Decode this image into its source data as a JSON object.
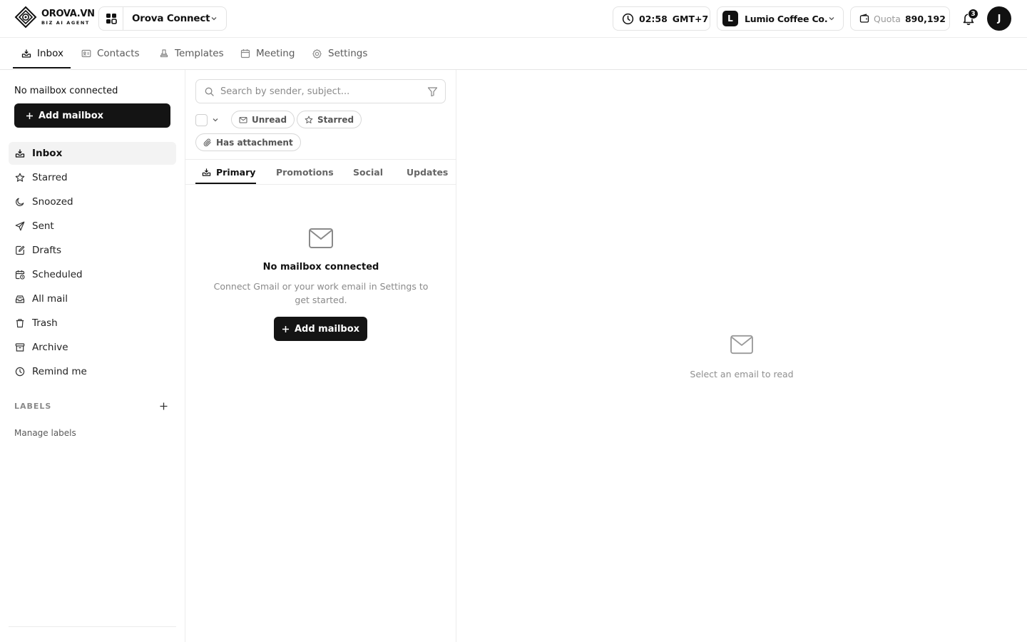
{
  "brand": {
    "name": "OROVA.VN",
    "tagline": "BIZ AI AGENT"
  },
  "app_switcher": {
    "current_app": "Orova Connect"
  },
  "clock": {
    "time": "02:58",
    "timezone": "GMT+7"
  },
  "org": {
    "initial": "L",
    "name": "Lumio Coffee Co."
  },
  "quota": {
    "label": "Quota",
    "value": "890,192"
  },
  "notifications": {
    "count": "3"
  },
  "user": {
    "initial": "J"
  },
  "nav": {
    "tabs": [
      {
        "label": "Inbox",
        "icon": "inbox-icon",
        "active": true
      },
      {
        "label": "Contacts",
        "icon": "contact-card-icon"
      },
      {
        "label": "Templates",
        "icon": "stamp-icon"
      },
      {
        "label": "Meeting",
        "icon": "calendar-icon"
      },
      {
        "label": "Settings",
        "icon": "gear-icon"
      }
    ]
  },
  "sidebar": {
    "status": "No mailbox connected",
    "add_mailbox_label": "Add mailbox",
    "folders": [
      {
        "label": "Inbox",
        "icon": "inbox-icon",
        "active": true
      },
      {
        "label": "Starred",
        "icon": "star-icon"
      },
      {
        "label": "Snoozed",
        "icon": "moon-icon"
      },
      {
        "label": "Sent",
        "icon": "send-icon"
      },
      {
        "label": "Drafts",
        "icon": "draft-icon"
      },
      {
        "label": "Scheduled",
        "icon": "calendar-clock-icon"
      },
      {
        "label": "All mail",
        "icon": "mailbox-icon"
      },
      {
        "label": "Trash",
        "icon": "trash-icon"
      },
      {
        "label": "Archive",
        "icon": "archive-icon"
      },
      {
        "label": "Remind me",
        "icon": "clock-icon"
      }
    ],
    "labels_heading": "LABELS",
    "manage_labels": "Manage labels"
  },
  "list": {
    "search_placeholder": "Search by sender, subject...",
    "chips": [
      "Unread",
      "Starred",
      "Has attachment"
    ],
    "categories": [
      {
        "label": "Primary",
        "active": true
      },
      {
        "label": "Promotions"
      },
      {
        "label": "Social"
      },
      {
        "label": "Updates"
      }
    ],
    "empty": {
      "title": "No mailbox connected",
      "description": "Connect Gmail or your work email in Settings to get started.",
      "button_label": "Add mailbox"
    }
  },
  "reader": {
    "placeholder": "Select an email to read"
  }
}
